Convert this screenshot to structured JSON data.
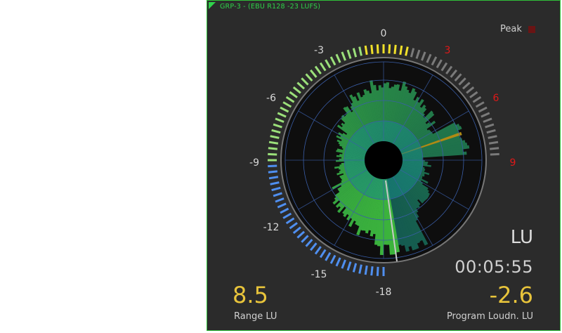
{
  "panel": {
    "title": "GRP-3 - (EBU R128 -23 LUFS)",
    "peak_label": "Peak",
    "unit": "LU",
    "time": "00:05:55",
    "range_value": "8.5",
    "range_label": "Range LU",
    "program_value": "-2.6",
    "program_label": "Program Loudn. LU"
  },
  "scale_ticks": [
    "0",
    "3",
    "6",
    "9",
    "-3",
    "-6",
    "-9",
    "-12",
    "-15",
    "-18"
  ],
  "over_ticks": [
    "3",
    "6",
    "9"
  ],
  "colors": {
    "panel_border": "#2fbf3a",
    "accent_value": "#e8c43b",
    "over_tick": "#e01818",
    "scale_blue": "#4f8ff0",
    "scale_green": "#9be07a",
    "scale_yellow": "#f0e02a",
    "scale_gray": "#7a7a7a",
    "peak_led": "#6a1414"
  }
}
